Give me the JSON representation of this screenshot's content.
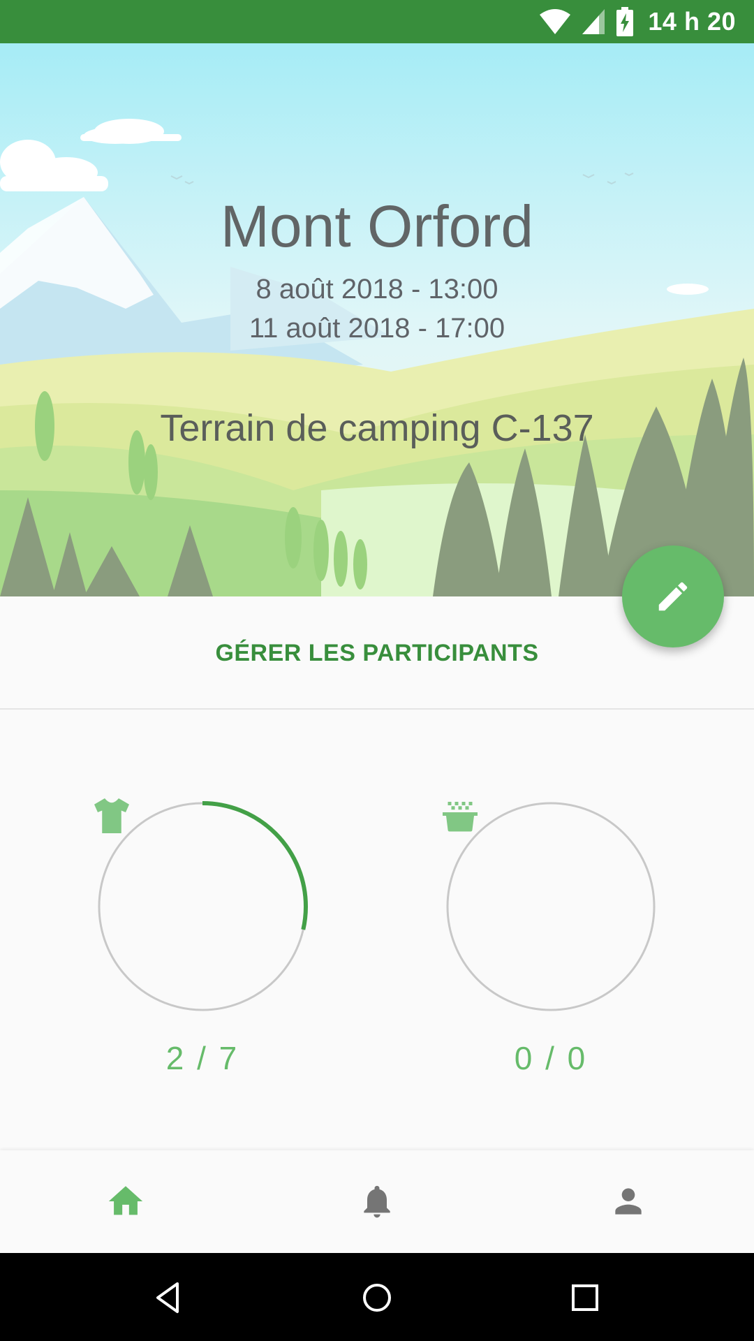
{
  "status_bar": {
    "time": "14 h 20",
    "icons": [
      "wifi-icon",
      "signal-icon",
      "battery-charging-icon"
    ],
    "color": "#388e3c"
  },
  "event": {
    "title": "Mont Orford",
    "start": "8 août 2018 - 13:00",
    "end": "11 août 2018 - 17:00",
    "location": "Terrain de camping C-137"
  },
  "fab": {
    "icon": "pencil-icon",
    "color": "#66bb6a"
  },
  "manage_participants_label": "GÉRER LES PARTICIPANTS",
  "gauges": [
    {
      "icon": "tshirt-icon",
      "label": "2 / 7",
      "progress": 0.2857
    },
    {
      "icon": "cooking-pot-icon",
      "label": "0 / 0",
      "progress": 0
    }
  ],
  "bottom_nav": {
    "items": [
      {
        "icon": "home-icon",
        "active": true
      },
      {
        "icon": "bell-icon",
        "active": false
      },
      {
        "icon": "person-icon",
        "active": false
      }
    ],
    "active_color": "#66bb6a",
    "inactive_color": "#757575"
  },
  "system_nav": [
    "back-icon",
    "home-circle-icon",
    "recents-icon"
  ]
}
